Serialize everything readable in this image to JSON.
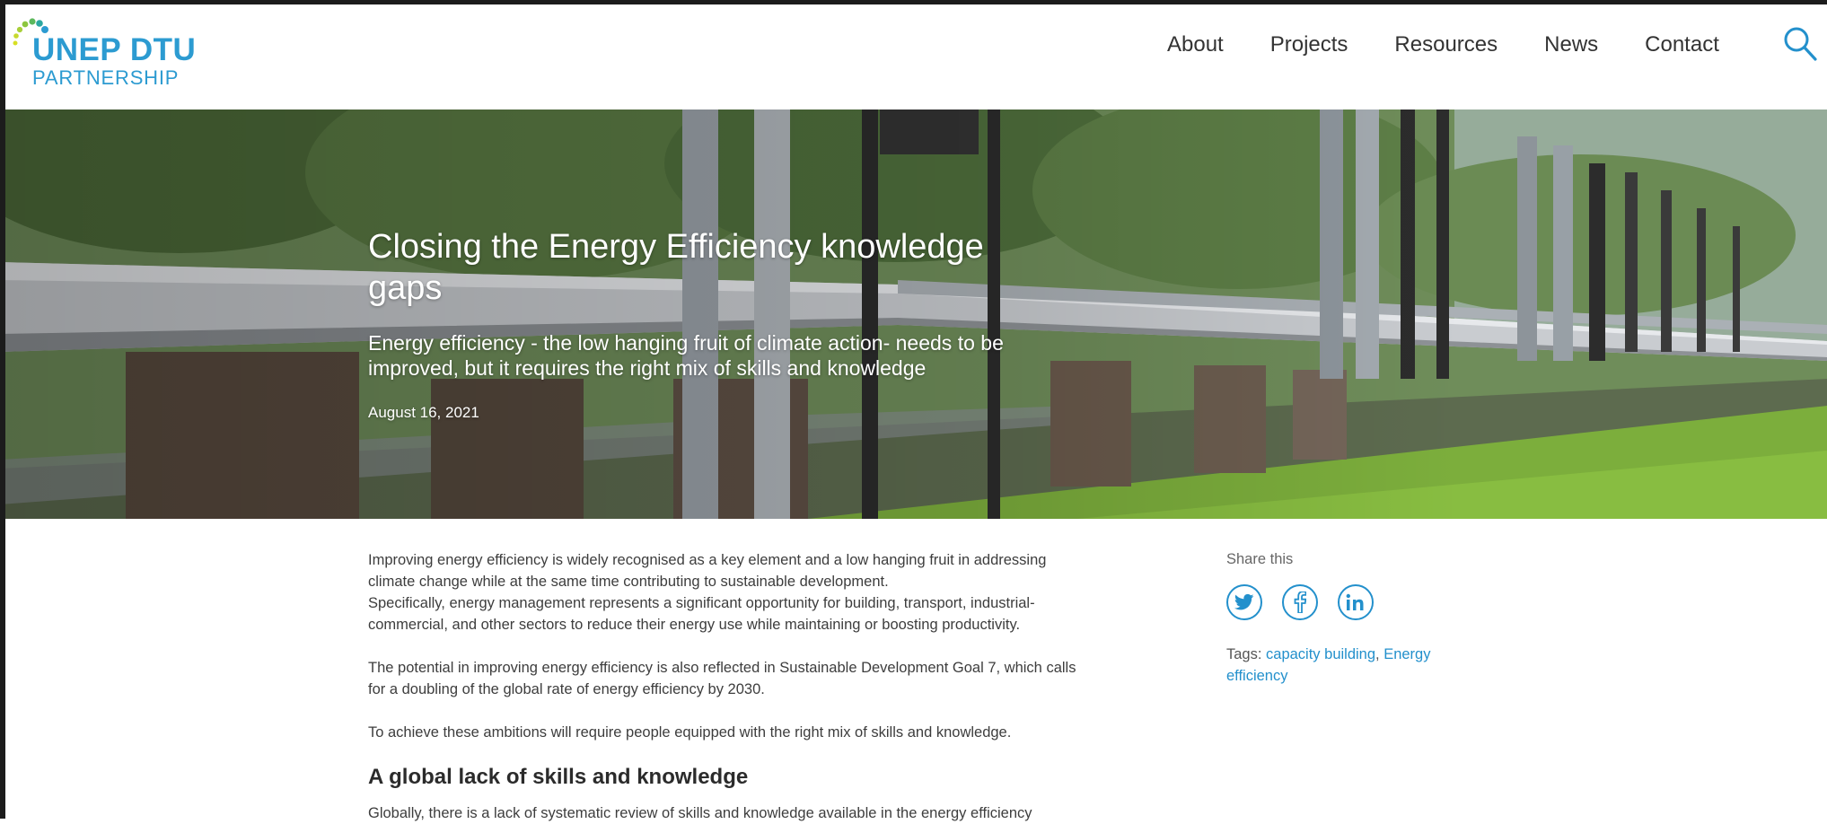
{
  "header": {
    "logo": {
      "main": "UNEP DTU",
      "sub": "PARTNERSHIP"
    },
    "nav": [
      "About",
      "Projects",
      "Resources",
      "News",
      "Contact"
    ],
    "search_icon": "search-icon"
  },
  "hero": {
    "title": "Closing the Energy Efficiency knowledge gaps",
    "subtitle": "Energy efficiency - the low hanging fruit of climate action- needs to be improved, but it requires the right mix of skills and knowledge",
    "date": "August 16, 2021"
  },
  "article": {
    "p1": "Improving energy efficiency is widely recognised as a key element and a low hanging fruit in addressing climate change while at the same time contributing to sustainable development.",
    "p1b": "Specifically, energy management represents a significant opportunity for building, transport, industrial-commercial, and other sectors to reduce their energy use while maintaining or boosting productivity.",
    "p2": "The potential in improving energy efficiency is also reflected in Sustainable Development Goal 7, which calls for a doubling of the global rate of energy efficiency by 2030.",
    "p3": "To achieve these ambitions will require people equipped with the right mix of skills and knowledge.",
    "heading": "A global lack of skills and knowledge",
    "p4": "Globally, there is a lack of systematic review of skills and knowledge available in the energy efficiency"
  },
  "sidebar": {
    "share_label": "Share this",
    "share_icons": [
      "twitter-icon",
      "facebook-icon",
      "linkedin-icon"
    ],
    "tags_label": "Tags:",
    "tags": [
      "capacity building",
      "Energy efficiency"
    ],
    "tag_separator": ", "
  },
  "colors": {
    "brand": "#2c9bd1",
    "link": "#2390cc",
    "logo_dot_green": "#8cc63f",
    "logo_dot_yellow": "#d7df23"
  }
}
